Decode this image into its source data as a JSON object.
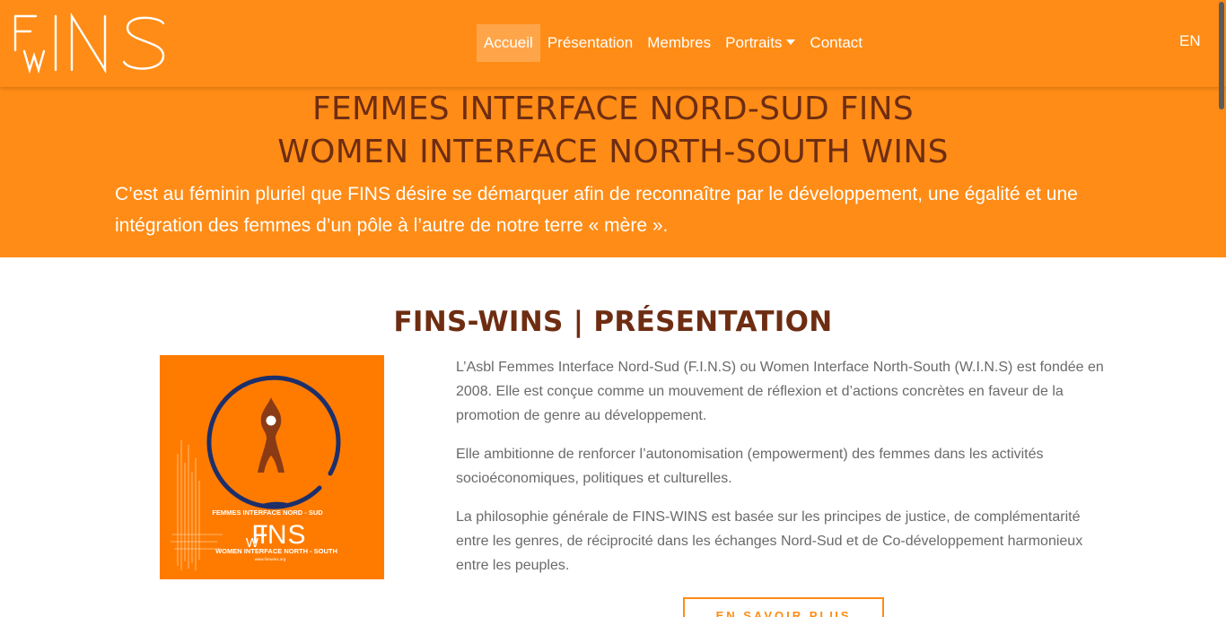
{
  "header": {
    "logo_alt": "FWINS",
    "nav": [
      {
        "label": "Accueil",
        "active": true
      },
      {
        "label": "Présentation",
        "active": false
      },
      {
        "label": "Membres",
        "active": false
      },
      {
        "label": "Portraits",
        "active": false,
        "dropdown": true
      },
      {
        "label": "Contact",
        "active": false
      }
    ],
    "lang": "EN"
  },
  "hero": {
    "title_fr": "FEMMES INTERFACE NORD-SUD FINS",
    "title_en": "WOMEN INTERFACE NORTH-SOUTH WINS",
    "text": "C’est au féminin pluriel que FINS désire se démarquer afin de reconnaître par le développement, une égalité et une intégration des femmes d’un pôle à l’autre de notre terre « mère »."
  },
  "presentation": {
    "title": "FINS-WINS | PRÉSENTATION",
    "image": {
      "top_text": "FEMMES  INTERFACE  NORD - SUD",
      "bottom_text": "WOMEN  INTERFACE  NORTH - SOUTH",
      "url": "www.finswins.org"
    },
    "paragraphs": [
      "L’Asbl Femmes Interface Nord-Sud (F.I.N.S) ou Women Interface North-South (W.I.N.S) est fondée en 2008. Elle est conçue comme un mouvement de réflexion et d’actions concrètes en faveur de la promotion de genre au développement.",
      "Elle ambitionne de renforcer l’autonomisation (empowerment) des femmes dans les activités socioéconomiques, politiques et culturelles.",
      "La philosophie générale de FINS-WINS est basée sur les principes de justice, de complémentarité entre les genres, de réciprocité dans les échanges Nord-Sud et de Co-développement harmonieux entre les peuples."
    ],
    "button_label": "EN SAVOIR PLUS"
  },
  "colors": {
    "brand_orange": "#ff8c16",
    "title_brown": "#6e2d12",
    "body_gray": "#6a6a6a",
    "logo_blue": "#1d2f6b"
  },
  "icons": {
    "caret": "chevron-down-icon"
  }
}
